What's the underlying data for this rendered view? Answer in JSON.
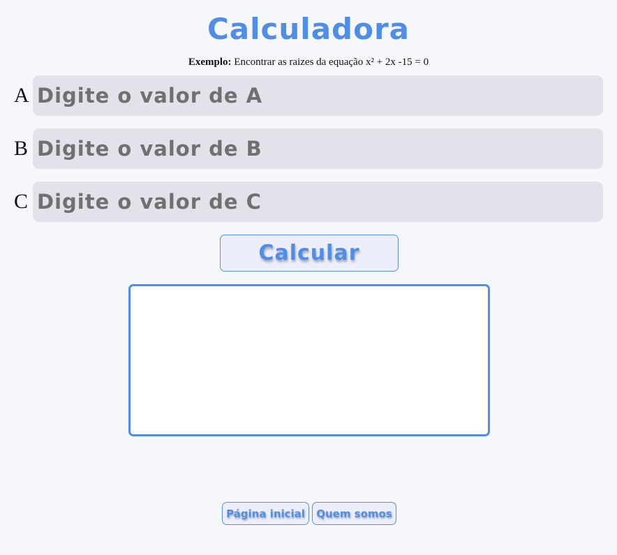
{
  "page": {
    "title": "Calculadora",
    "example_label": "Exemplo:",
    "example_text": " Encontrar as raizes da equação x² + 2x -15 = 0"
  },
  "form": {
    "fields": [
      {
        "label": "A",
        "placeholder": "Digite o valor de A",
        "value": ""
      },
      {
        "label": "B",
        "placeholder": "Digite o valor de B",
        "value": ""
      },
      {
        "label": "C",
        "placeholder": "Digite o valor de C",
        "value": ""
      }
    ],
    "calculate_label": "Calcular",
    "result_text": ""
  },
  "nav": {
    "home_label": "Página inicial",
    "about_label": "Quem somos"
  },
  "colors": {
    "accent": "#4f8ee8",
    "background": "#f6f7fb",
    "field_background": "#e2e3ea",
    "button_background": "#eceffb"
  }
}
